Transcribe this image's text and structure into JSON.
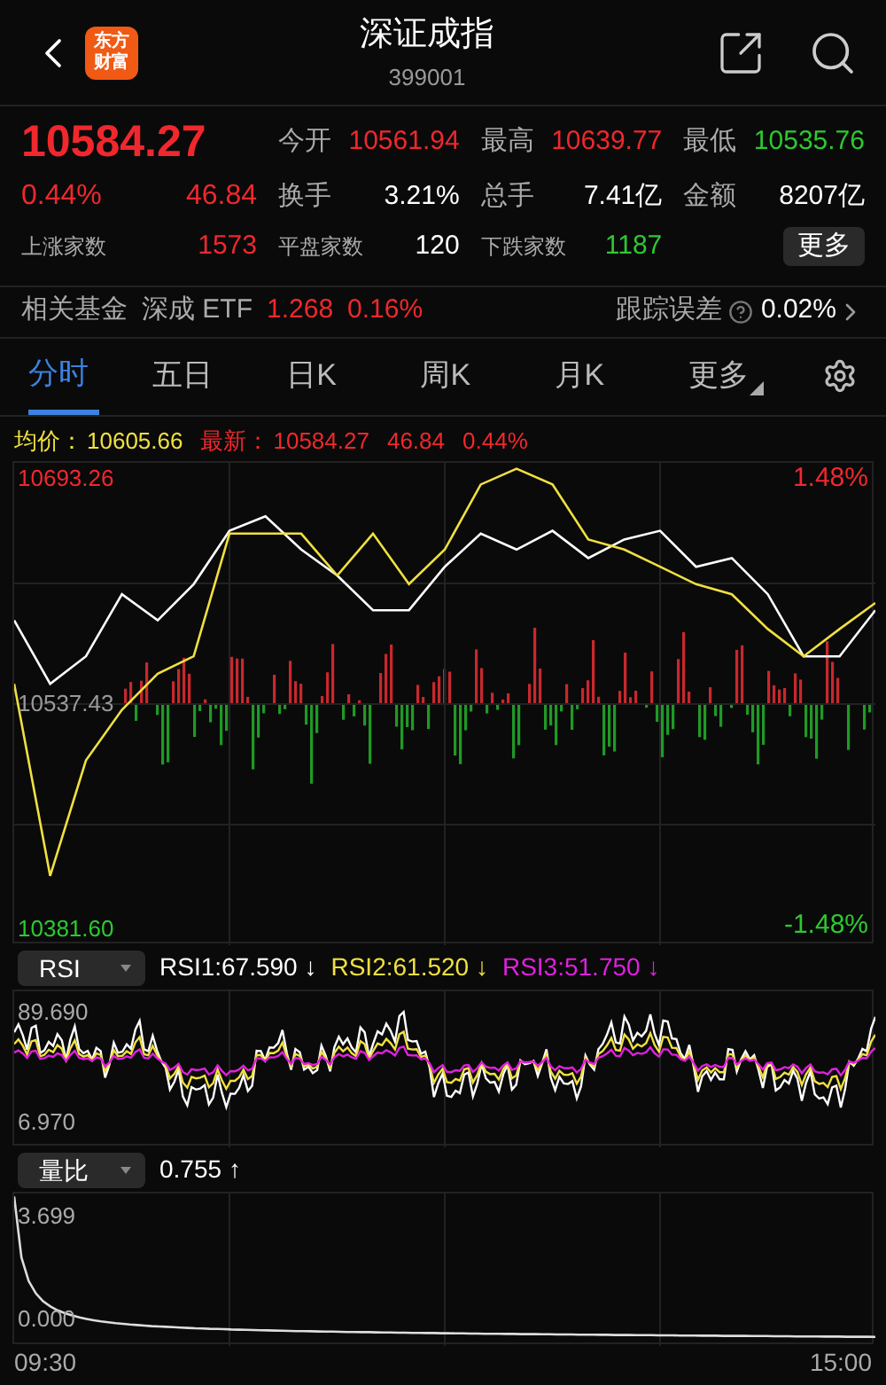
{
  "header": {
    "title": "深证成指",
    "code": "399001",
    "logo": [
      "东方",
      "财富"
    ]
  },
  "quote": {
    "price": "10584.27",
    "change_pct": "0.44%",
    "change": "46.84",
    "stats": [
      {
        "label": "今开",
        "value": "10561.94",
        "color": "#f0282d"
      },
      {
        "label": "最高",
        "value": "10639.77",
        "color": "#f0282d"
      },
      {
        "label": "最低",
        "value": "10535.76",
        "color": "#2ec832"
      },
      {
        "label": "换手",
        "value": "3.21%",
        "color": "#ffffff"
      },
      {
        "label": "总手",
        "value": "7.41亿",
        "color": "#ffffff"
      },
      {
        "label": "金额",
        "value": "8207亿",
        "color": "#ffffff"
      }
    ],
    "breadth": [
      {
        "label": "上涨家数",
        "value": "1573",
        "color": "#f0282d"
      },
      {
        "label": "平盘家数",
        "value": "120",
        "color": "#ffffff"
      },
      {
        "label": "下跌家数",
        "value": "1187",
        "color": "#2ec832"
      }
    ],
    "more_button": "更多"
  },
  "fund": {
    "label": "相关基金",
    "name": "深成 ETF",
    "price": "1.268",
    "change_pct": "0.16%",
    "tracking_label": "跟踪误差",
    "tracking_value": "0.02%"
  },
  "tabs": [
    {
      "label": "分时",
      "selected": true,
      "dropdown": false
    },
    {
      "label": "五日",
      "selected": false,
      "dropdown": false
    },
    {
      "label": "日K",
      "selected": false,
      "dropdown": false
    },
    {
      "label": "周K",
      "selected": false,
      "dropdown": false
    },
    {
      "label": "月K",
      "selected": false,
      "dropdown": false
    },
    {
      "label": "更多",
      "selected": false,
      "dropdown": true
    }
  ],
  "summary": {
    "avg_label": "均价：",
    "avg_value": "10605.66",
    "latest_label": "最新：",
    "latest_value": "10584.27",
    "latest_change": "46.84",
    "latest_pct": "0.44%"
  },
  "price_chart": {
    "high_pct": "1.48%",
    "low_pct": "-1.48%",
    "chart_data": {
      "type": "line",
      "ylim": [
        10371,
        10705
      ],
      "grid": true,
      "yticks": [
        {
          "value": 10693.26,
          "label": "10693.26"
        },
        {
          "value": 10537.43,
          "label": "10537.43"
        },
        {
          "value": 10381.6,
          "label": "10381.60"
        }
      ],
      "series": [
        {
          "color": "#ffffff",
          "values": [
            10596,
            10552,
            10571,
            10614,
            10596,
            10621,
            10658,
            10668,
            10645,
            10627,
            10603,
            10603,
            10633,
            10656,
            10645,
            10658,
            10639,
            10652,
            10658,
            10633,
            10639,
            10614,
            10571,
            10571,
            10603
          ]
        },
        {
          "color": "#f0e040",
          "values": [
            10552,
            10419,
            10499,
            10534,
            10559,
            10571,
            10656,
            10656,
            10656,
            10627,
            10656,
            10621,
            10645,
            10690,
            10701,
            10690,
            10652,
            10645,
            10633,
            10621,
            10614,
            10590,
            10571,
            10590,
            10608
          ]
        }
      ]
    }
  },
  "rsi": {
    "selector": "RSI",
    "lines": [
      {
        "label": "RSI1:67.590",
        "arrow": "↓",
        "color": "#ffffff"
      },
      {
        "label": "RSI2:61.520",
        "arrow": "↓",
        "color": "#f0e040"
      },
      {
        "label": "RSI3:51.750",
        "arrow": "↓",
        "color": "#e020e0"
      }
    ],
    "max": "89.690",
    "min": "6.970"
  },
  "volume_ratio": {
    "selector": "量比",
    "value": "0.755",
    "arrow": "↑",
    "max": "3.699",
    "min": "0.000"
  },
  "time_axis": {
    "start": "09:30",
    "end": "15:00"
  }
}
